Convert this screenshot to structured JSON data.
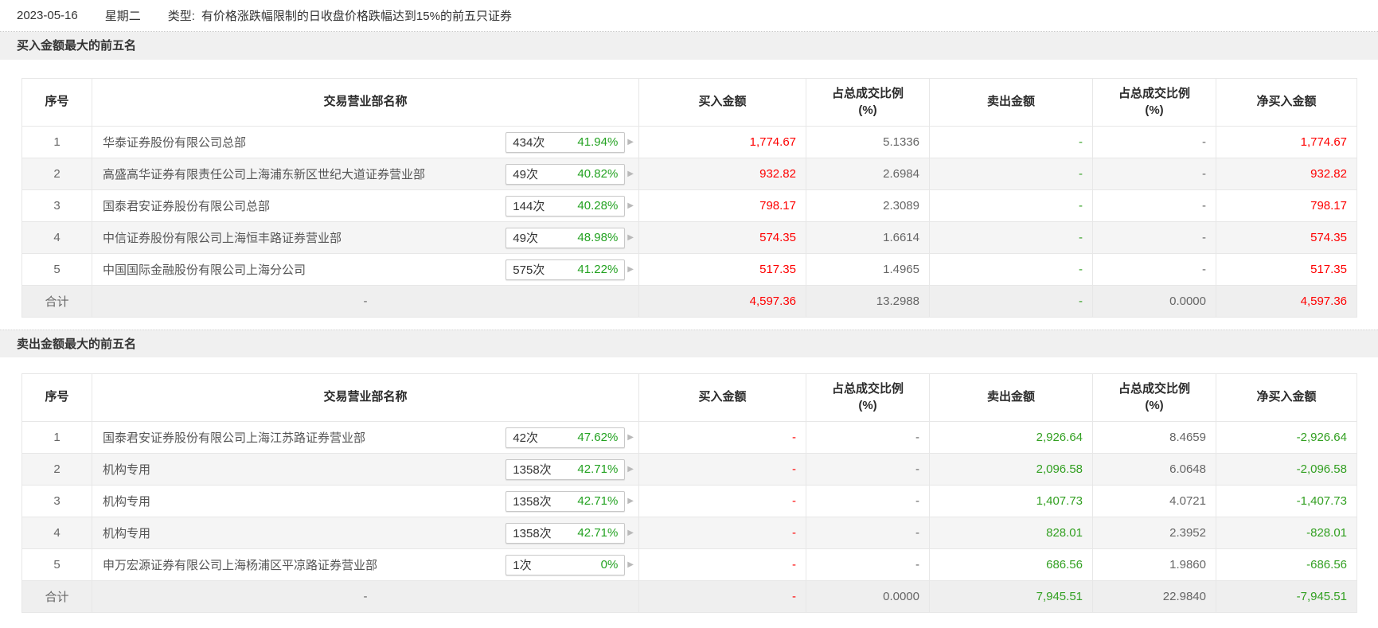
{
  "page": {
    "date": "2023-05-16",
    "weekday": "星期二",
    "type_label": "类型:",
    "type_text": "有价格涨跌幅限制的日收盘价格跌幅达到15%的前五只证券"
  },
  "icons": {
    "chevron_right": "▶"
  },
  "colors": {
    "red": "#fe0000",
    "green": "#33a022",
    "badge_green": "#23a221",
    "stripe": "#f5f5f5",
    "total_bg": "#efefef",
    "section_bg": "#f0f0f0"
  },
  "columns": {
    "seq": "序号",
    "broker": "交易营业部名称",
    "buy": "买入金额",
    "ratio_line1": "占总成交比例",
    "ratio_line2": "(%)",
    "sell": "卖出金额",
    "net": "净买入金额"
  },
  "buy_section": {
    "title": "买入金额最大的前五名",
    "rows": [
      {
        "idx": "1",
        "name": "华泰证券股份有限公司总部",
        "count": "434次",
        "pct": "41.94%",
        "buy": "1,774.67",
        "buy_ratio": "5.1336",
        "sell": "-",
        "sell_ratio": "-",
        "net": "1,774.67"
      },
      {
        "idx": "2",
        "name": "高盛高华证券有限责任公司上海浦东新区世纪大道证券营业部",
        "count": "49次",
        "pct": "40.82%",
        "buy": "932.82",
        "buy_ratio": "2.6984",
        "sell": "-",
        "sell_ratio": "-",
        "net": "932.82"
      },
      {
        "idx": "3",
        "name": "国泰君安证券股份有限公司总部",
        "count": "144次",
        "pct": "40.28%",
        "buy": "798.17",
        "buy_ratio": "2.3089",
        "sell": "-",
        "sell_ratio": "-",
        "net": "798.17"
      },
      {
        "idx": "4",
        "name": "中信证券股份有限公司上海恒丰路证券营业部",
        "count": "49次",
        "pct": "48.98%",
        "buy": "574.35",
        "buy_ratio": "1.6614",
        "sell": "-",
        "sell_ratio": "-",
        "net": "574.35"
      },
      {
        "idx": "5",
        "name": "中国国际金融股份有限公司上海分公司",
        "count": "575次",
        "pct": "41.22%",
        "buy": "517.35",
        "buy_ratio": "1.4965",
        "sell": "-",
        "sell_ratio": "-",
        "net": "517.35"
      }
    ],
    "total": {
      "label": "合计",
      "name": "-",
      "buy": "4,597.36",
      "buy_ratio": "13.2988",
      "sell": "-",
      "sell_ratio": "0.0000",
      "net": "4,597.36"
    }
  },
  "sell_section": {
    "title": "卖出金额最大的前五名",
    "rows": [
      {
        "idx": "1",
        "name": "国泰君安证券股份有限公司上海江苏路证券营业部",
        "count": "42次",
        "pct": "47.62%",
        "buy": "-",
        "buy_ratio": "-",
        "sell": "2,926.64",
        "sell_ratio": "8.4659",
        "net": "-2,926.64"
      },
      {
        "idx": "2",
        "name": "机构专用",
        "count": "1358次",
        "pct": "42.71%",
        "buy": "-",
        "buy_ratio": "-",
        "sell": "2,096.58",
        "sell_ratio": "6.0648",
        "net": "-2,096.58"
      },
      {
        "idx": "3",
        "name": "机构专用",
        "count": "1358次",
        "pct": "42.71%",
        "buy": "-",
        "buy_ratio": "-",
        "sell": "1,407.73",
        "sell_ratio": "4.0721",
        "net": "-1,407.73"
      },
      {
        "idx": "4",
        "name": "机构专用",
        "count": "1358次",
        "pct": "42.71%",
        "buy": "-",
        "buy_ratio": "-",
        "sell": "828.01",
        "sell_ratio": "2.3952",
        "net": "-828.01"
      },
      {
        "idx": "5",
        "name": "申万宏源证券有限公司上海杨浦区平凉路证券营业部",
        "count": "1次",
        "pct": "0%",
        "buy": "-",
        "buy_ratio": "-",
        "sell": "686.56",
        "sell_ratio": "1.9860",
        "net": "-686.56"
      }
    ],
    "total": {
      "label": "合计",
      "name": "-",
      "buy": "-",
      "buy_ratio": "0.0000",
      "sell": "7,945.51",
      "sell_ratio": "22.9840",
      "net": "-7,945.51"
    }
  }
}
